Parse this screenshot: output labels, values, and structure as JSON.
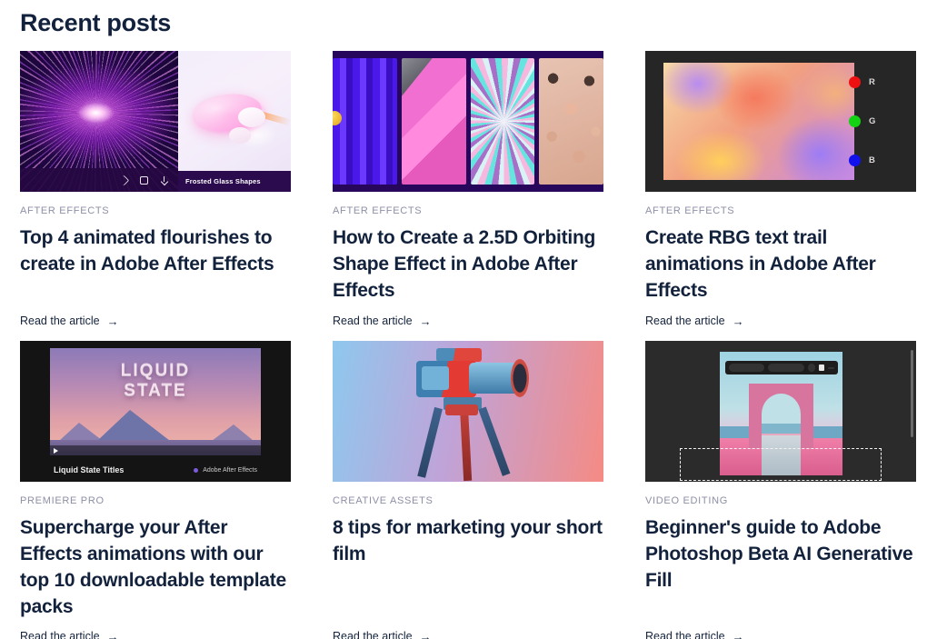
{
  "section": {
    "title": "Recent posts"
  },
  "cards": [
    {
      "eyebrow": "AFTER EFFECTS",
      "title": "Top 4 animated flourishes to create in Adobe After Effects",
      "cta": "Read the article",
      "arrow": "→",
      "thumb": {
        "kind": "particle-burst-frosted-glass",
        "caption": "Frosted Glass Shapes",
        "toolbar_icons": [
          "share-icon",
          "save-icon",
          "download-icon"
        ]
      }
    },
    {
      "eyebrow": "AFTER EFFECTS",
      "title": "How to Create a 2.5D Orbiting Shape Effect in Adobe After Effects",
      "cta": "Read the article",
      "arrow": "→",
      "thumb": {
        "kind": "four-vertical-abstract-panels"
      }
    },
    {
      "eyebrow": "AFTER EFFECTS",
      "title": "Create RBG text trail animations in Adobe After Effects",
      "cta": "Read the article",
      "arrow": "→",
      "thumb": {
        "kind": "rgb-channel-panel",
        "channels": [
          {
            "label": "R",
            "color": "#ee1111"
          },
          {
            "label": "G",
            "color": "#12d212"
          },
          {
            "label": "B",
            "color": "#1111ee"
          }
        ]
      }
    },
    {
      "eyebrow": "PREMIERE PRO",
      "title": "Supercharge your After Effects animations with our top 10 downloadable template packs",
      "cta": "Read the article",
      "arrow": "→",
      "thumb": {
        "kind": "video-preview",
        "overlay_text_line1": "LIQUID",
        "overlay_text_line2": "STATE",
        "file_name": "Liquid State Titles",
        "app_tag": "Adobe After Effects"
      }
    },
    {
      "eyebrow": "CREATIVE ASSETS",
      "title": "8 tips for marketing your short film",
      "cta": "Read the article",
      "arrow": "→",
      "thumb": {
        "kind": "camera-on-tripod"
      }
    },
    {
      "eyebrow": "VIDEO EDITING",
      "title": "Beginner's guide to Adobe Photoshop Beta AI Generative Fill",
      "cta": "Read the article",
      "arrow": "→",
      "thumb": {
        "kind": "photoshop-generative-fill"
      }
    }
  ],
  "colors": {
    "text_primary": "#13223c",
    "eyebrow": "#8d8fa6",
    "background": "#ffffff"
  }
}
